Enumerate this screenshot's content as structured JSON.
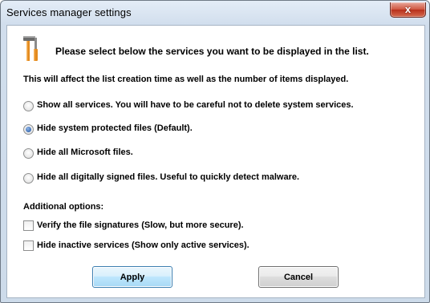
{
  "window": {
    "title": "Services manager settings",
    "close_glyph": "x"
  },
  "content": {
    "header": "Please select below the services you want to be displayed in the list.",
    "info": "This will affect the list creation time as well as the number of items displayed.",
    "radio_options": [
      {
        "label": "Show all services. You will have to be careful not to delete system services.",
        "selected": false
      },
      {
        "label": "Hide system protected files (Default).",
        "selected": true
      },
      {
        "label": "Hide all Microsoft files.",
        "selected": false
      },
      {
        "label": "Hide all digitally signed files. Useful to quickly detect malware.",
        "selected": false
      }
    ],
    "additional_header": "Additional options:",
    "checkboxes": [
      {
        "label": "Verify the file signatures (Slow, but more secure).",
        "checked": false
      },
      {
        "label": "Hide inactive services (Show only active services).",
        "checked": false
      }
    ]
  },
  "buttons": {
    "apply": "Apply",
    "cancel": "Cancel"
  },
  "icons": {
    "tools": "tools-icon"
  },
  "colors": {
    "radio_dot": "#1b4f9c",
    "apply_border": "#3c7fb1",
    "close_button": "#cf553f"
  }
}
